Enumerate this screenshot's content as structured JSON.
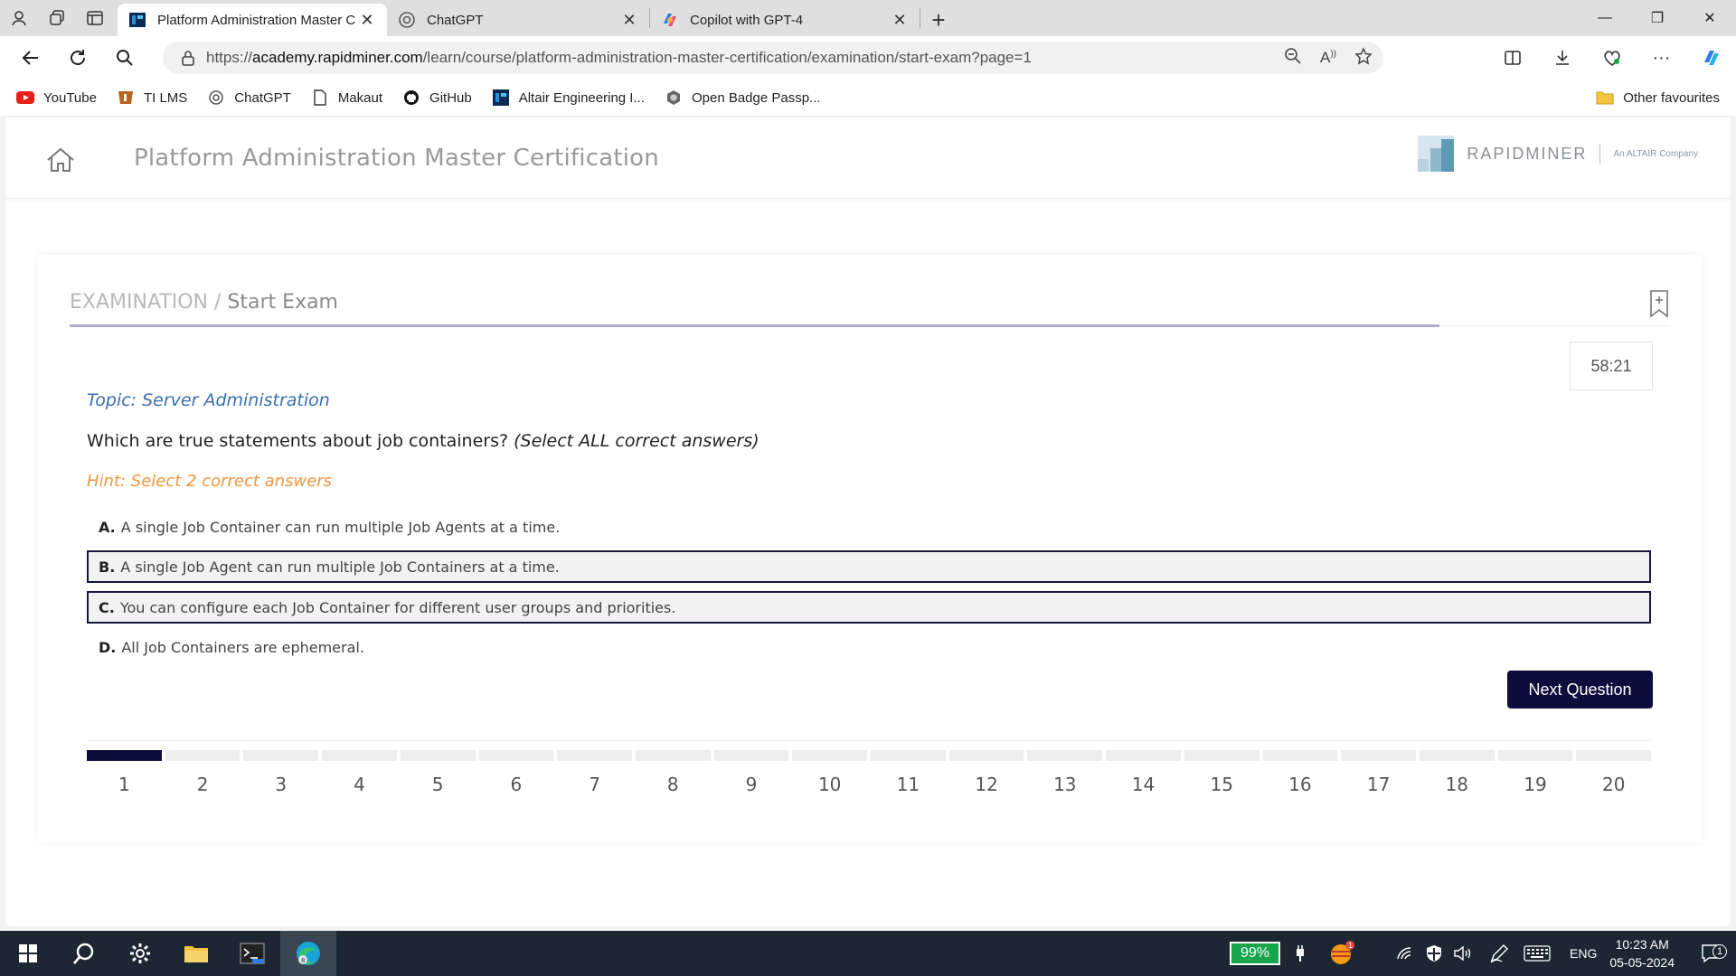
{
  "browser": {
    "tabs": [
      {
        "title": "Platform Administration Master C",
        "active": true
      },
      {
        "title": "ChatGPT",
        "active": false
      },
      {
        "title": "Copilot with GPT-4",
        "active": false
      }
    ],
    "url_prefix": "https://",
    "url_domain": "academy.rapidminer.com",
    "url_path": "/learn/course/platform-administration-master-certification/examination/start-exam?page=1",
    "bookmarks": [
      {
        "label": "YouTube",
        "icon": "youtube-icon"
      },
      {
        "label": "TI LMS",
        "icon": "ti-icon"
      },
      {
        "label": "ChatGPT",
        "icon": "chatgpt-icon"
      },
      {
        "label": "Makaut",
        "icon": "page-icon"
      },
      {
        "label": "GitHub",
        "icon": "github-icon"
      },
      {
        "label": "Altair Engineering I...",
        "icon": "altair-icon"
      },
      {
        "label": "Open Badge Passp...",
        "icon": "badge-icon"
      }
    ],
    "other_favourites": "Other favourites"
  },
  "header": {
    "course_title": "Platform Administration Master Certification",
    "logo_word": "RAPIDMINER",
    "logo_sub": "An ALTAIR Company"
  },
  "exam": {
    "breadcrumb_root": "EXAMINATION",
    "breadcrumb_sep": " / ",
    "breadcrumb_current": "Start Exam",
    "timer": "58:21",
    "topic": "Topic: Server Administration",
    "question": "Which are true statements about job containers? ",
    "question_note": "(Select ALL correct answers)",
    "hint": "Hint: Select 2 correct answers",
    "options": [
      {
        "letter": "A.",
        "text": "A single Job Container can run multiple Job Agents at a time.",
        "selected": false
      },
      {
        "letter": "B.",
        "text": "A single Job Agent can run multiple Job Containers at a time.",
        "selected": true
      },
      {
        "letter": "C.",
        "text": "You can configure each Job Container for different user groups and priorities.",
        "selected": true
      },
      {
        "letter": "D.",
        "text": "All Job Containers are ephemeral.",
        "selected": false
      }
    ],
    "next_label": "Next Question",
    "questions": [
      "1",
      "2",
      "3",
      "4",
      "5",
      "6",
      "7",
      "8",
      "9",
      "10",
      "11",
      "12",
      "13",
      "14",
      "15",
      "16",
      "17",
      "18",
      "19",
      "20"
    ],
    "current_question": 1
  },
  "taskbar": {
    "battery": "99%",
    "language": "ENG",
    "time": "10:23 AM",
    "date": "05-05-2024",
    "notifications": "1"
  },
  "colors": {
    "accent": "#0e0c3a",
    "topic": "#3a6fb0",
    "hint": "#f0963f",
    "battery": "#19a54b"
  }
}
